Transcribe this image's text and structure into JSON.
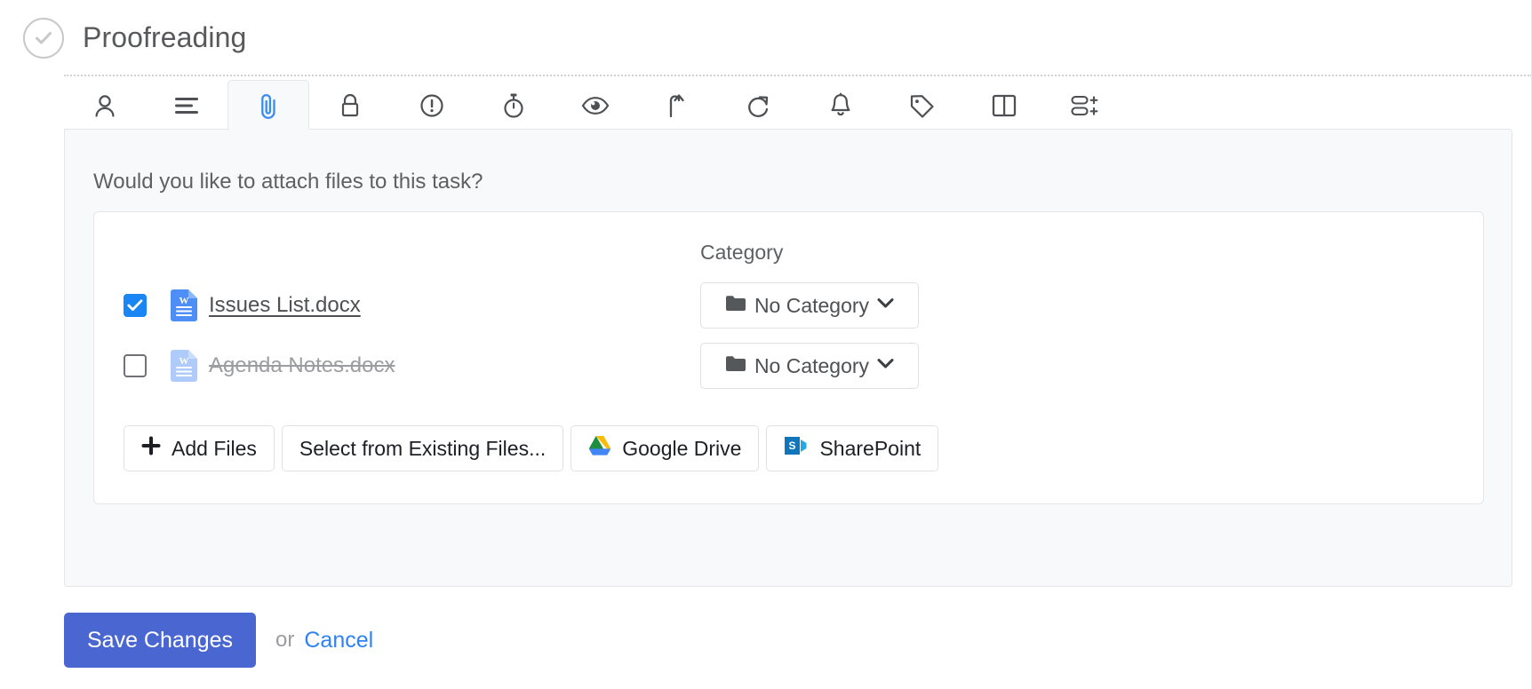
{
  "header": {
    "complete_icon": "check-circle-icon",
    "title": "Proofreading"
  },
  "tabs": [
    {
      "name": "people",
      "icon": "person-icon",
      "active": false
    },
    {
      "name": "description",
      "icon": "lines-icon",
      "active": false
    },
    {
      "name": "files",
      "icon": "paperclip-icon",
      "active": true
    },
    {
      "name": "permissions",
      "icon": "lock-icon",
      "active": false
    },
    {
      "name": "priority",
      "icon": "exclamation-circle-icon",
      "active": false
    },
    {
      "name": "time",
      "icon": "stopwatch-icon",
      "active": false
    },
    {
      "name": "watchers",
      "icon": "eye-icon",
      "active": false
    },
    {
      "name": "dependency",
      "icon": "arrow-up-turn-icon",
      "active": false
    },
    {
      "name": "recurring",
      "icon": "redo-icon",
      "active": false
    },
    {
      "name": "reminders",
      "icon": "bell-icon",
      "active": false
    },
    {
      "name": "tags",
      "icon": "tag-icon",
      "active": false
    },
    {
      "name": "columns",
      "icon": "columns-icon",
      "active": false
    },
    {
      "name": "custom-fields",
      "icon": "add-fields-icon",
      "active": false
    }
  ],
  "panel": {
    "prompt": "Would you like to attach files to this task?",
    "category_header": "Category",
    "files": [
      {
        "name": "Issues List.docx",
        "checked": true,
        "disabled": false,
        "icon": "word-document-icon",
        "category": "No Category",
        "category_icon": "folder-icon",
        "chevron_icon": "chevron-down-icon"
      },
      {
        "name": "Agenda Notes.docx",
        "checked": false,
        "disabled": true,
        "icon": "word-document-icon",
        "category": "No Category",
        "category_icon": "folder-icon",
        "chevron_icon": "chevron-down-icon"
      }
    ],
    "source_buttons": [
      {
        "label": "Add Files",
        "icon": "plus-icon"
      },
      {
        "label": "Select from Existing Files...",
        "icon": ""
      },
      {
        "label": "Google Drive",
        "icon": "google-drive-icon"
      },
      {
        "label": "SharePoint",
        "icon": "sharepoint-icon"
      }
    ]
  },
  "footer": {
    "save_label": "Save Changes",
    "or_label": "or",
    "cancel_label": "Cancel"
  },
  "colors": {
    "accent_blue": "#4a67d1",
    "link_blue": "#2f82f3",
    "checkbox_blue": "#1a85f5",
    "panel_bg": "#f8f9fa",
    "border": "#e4e6e8",
    "text": "#4e5053",
    "muted_text": "#9b9da0"
  }
}
